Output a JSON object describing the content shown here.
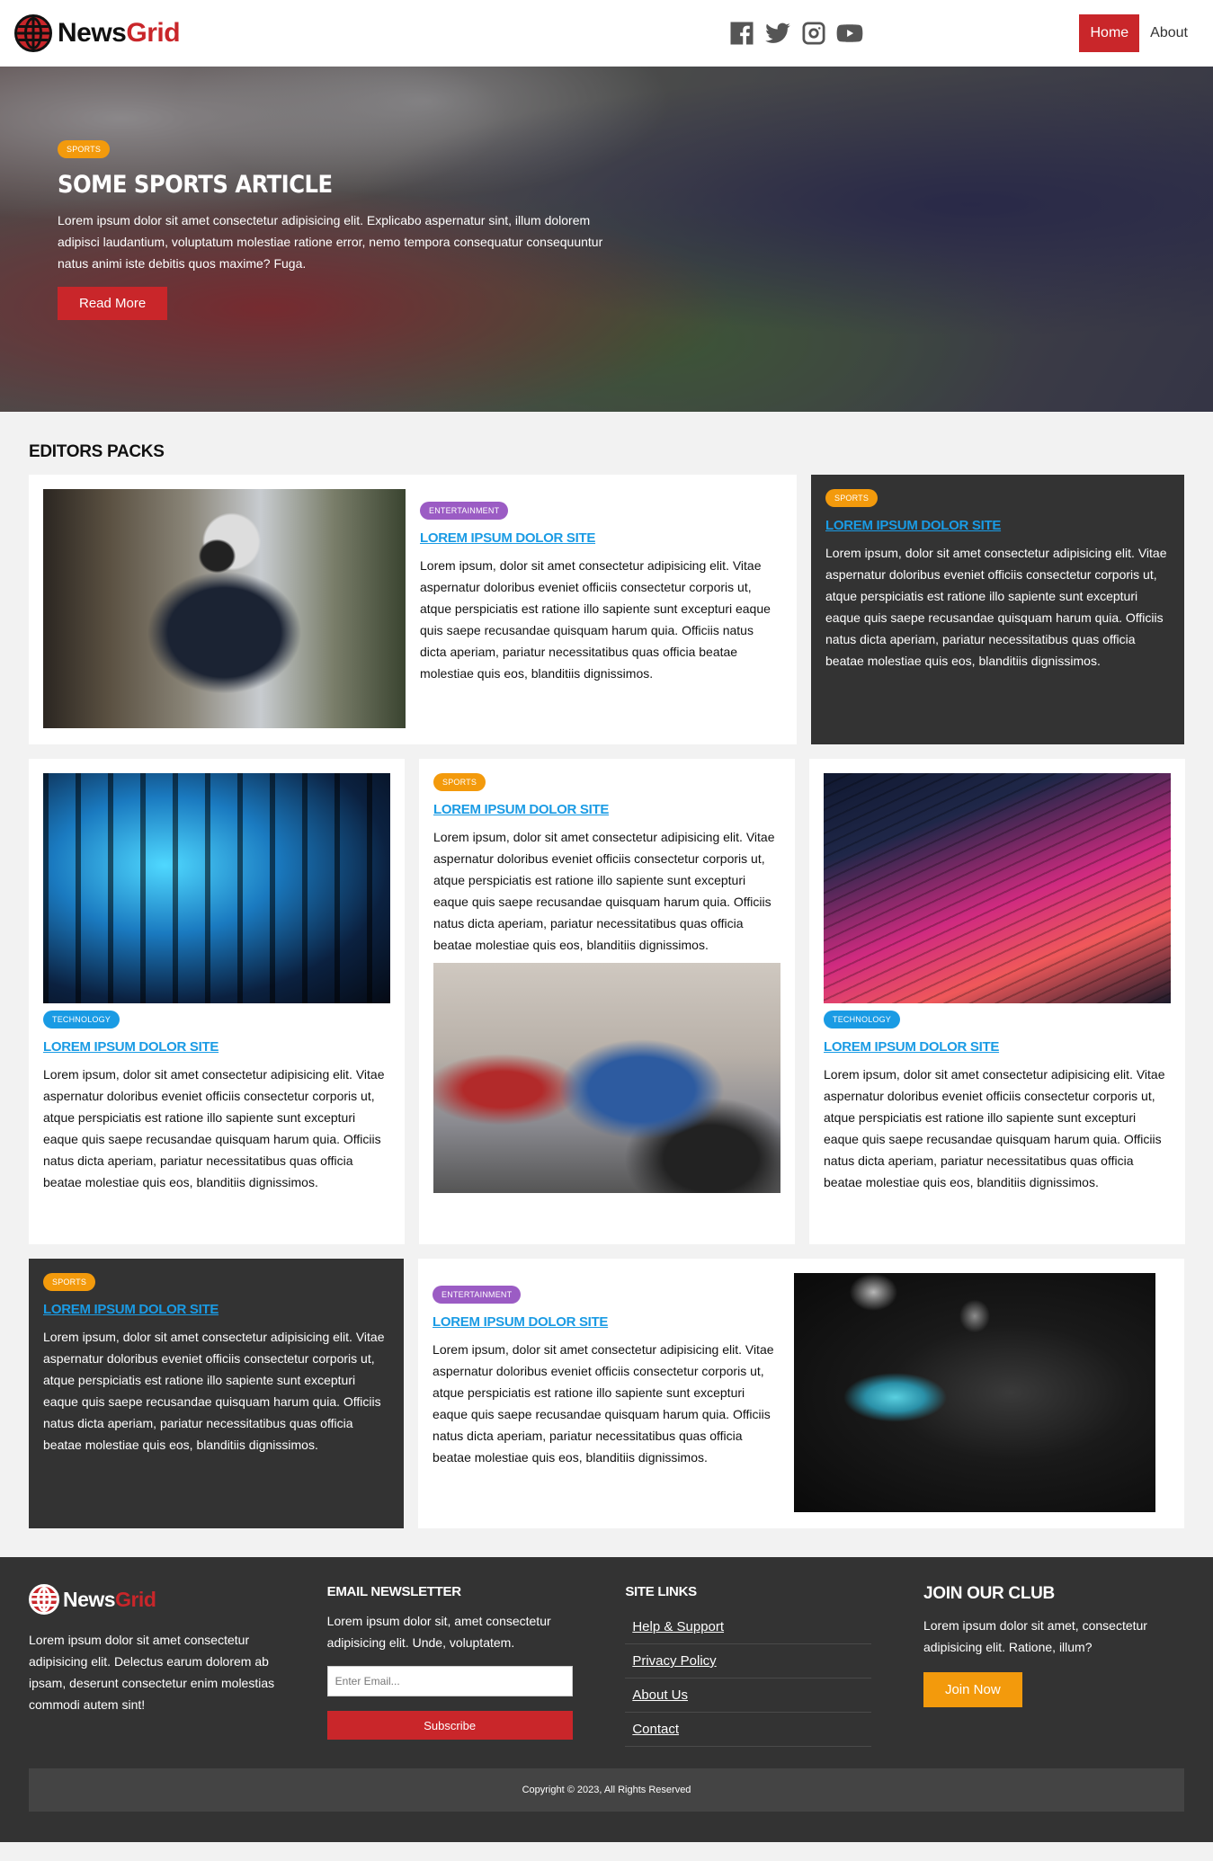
{
  "header": {
    "logo_news": "News",
    "logo_grid": "Grid",
    "social": [
      "facebook-icon",
      "twitter-icon",
      "instagram-icon",
      "youtube-icon"
    ],
    "nav": [
      {
        "label": "Home",
        "active": true
      },
      {
        "label": "About",
        "active": false
      }
    ]
  },
  "hero": {
    "badge": "SPORTS",
    "title": "SOME SPORTS ARTICLE",
    "text": "Lorem ipsum dolor sit amet consectetur adipisicing elit. Explicabo aspernatur sint, illum dolorem adipisci laudantium, voluptatum molestiae ratione error, nemo tempora consequatur consequuntur natus animi iste debitis quos maxime? Fuga.",
    "button": "Read More"
  },
  "editors": {
    "title": "EDITORS PACKS",
    "body_short": "Lorem ipsum, dolor sit amet consectetur adipisicing elit. Vitae aspernatur doloribus eveniet officiis consectetur corporis ut, atque perspiciatis est ratione illo sapiente sunt excepturi eaque quis saepe recusandae quisquam harum quia. Officiis natus dicta aperiam, pariatur necessitatibus quas officia beatae molestiae quis eos, blanditiis dignissimos.",
    "cards": [
      {
        "badge": "ENTERTAINMENT",
        "title": "LOREM IPSUM DOLOR SITE"
      },
      {
        "badge": "SPORTS",
        "title": "LOREM IPSUM DOLOR SITE"
      },
      {
        "badge": "TECHNOLOGY",
        "title": "LOREM IPSUM DOLOR SITE"
      },
      {
        "badge": "SPORTS",
        "title": "LOREM IPSUM DOLOR SITE"
      },
      {
        "badge": "TECHNOLOGY",
        "title": "LOREM IPSUM DOLOR SITE"
      },
      {
        "badge": "SPORTS",
        "title": "LOREM IPSUM DOLOR SITE"
      },
      {
        "badge": "ENTERTAINMENT",
        "title": "LOREM IPSUM DOLOR SITE"
      }
    ]
  },
  "footer": {
    "logo_news": "News",
    "logo_grid": "Grid",
    "about": "Lorem ipsum dolor sit amet consectetur adipisicing elit. Delectus earum dolorem ab ipsam, deserunt consectetur enim molestias commodi autem sint!",
    "newsletter_title": "EMAIL NEWSLETTER",
    "newsletter_text": "Lorem ipsum dolor sit, amet consectetur adipisicing elit. Unde, voluptatem.",
    "email_placeholder": "Enter Email...",
    "subscribe": "Subscribe",
    "links_title": "SITE LINKS",
    "links": [
      "Help & Support",
      "Privacy Policy",
      "About Us",
      "Contact"
    ],
    "club_title": "JOIN OUR CLUB",
    "club_text": "Lorem ipsum dolor sit amet, consectetur adipisicing elit. Ratione, illum?",
    "join": "Join Now",
    "copyright": "Copyright © 2023, All Rights Reserved"
  },
  "colors": {
    "brand_red": "#c9262a",
    "sports": "#f39a0c",
    "entertainment": "#9b5cc4",
    "technology": "#1a9be4",
    "dark": "#333333"
  }
}
